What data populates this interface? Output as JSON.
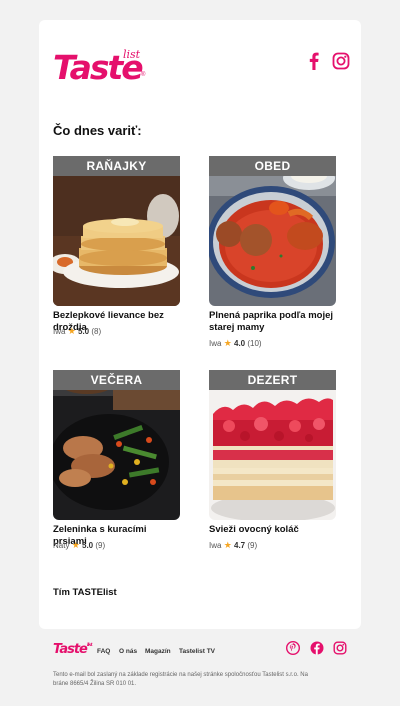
{
  "brand": {
    "name": "Taste",
    "suffix": "list",
    "accent": "#e5106c"
  },
  "header": {
    "social": [
      "facebook-icon",
      "instagram-icon"
    ]
  },
  "heading": "Čo dnes variť:",
  "recipes": [
    {
      "tag": "RAŇAJKY",
      "title": "Bezlepkové lievance bez droždia",
      "author": "Iwa",
      "rating": "5.0",
      "count": "(8)"
    },
    {
      "tag": "OBED",
      "title": "Plnená paprika podľa mojej starej mamy",
      "author": "Iwa",
      "rating": "4.0",
      "count": "(10)"
    },
    {
      "tag": "VEČERA",
      "title": "Zeleninka s kuracími prsiami",
      "author": "Naty",
      "rating": "5.0",
      "count": "(9)"
    },
    {
      "tag": "DEZERT",
      "title": "Svieži ovocný koláč",
      "author": "Iwa",
      "rating": "4.7",
      "count": "(9)"
    }
  ],
  "signoff": "Tím TASTElist",
  "footer": {
    "links": [
      "FAQ",
      "O nás",
      "Magazín",
      "Tastelist TV"
    ],
    "social": [
      "pinterest-icon",
      "facebook-icon",
      "instagram-icon"
    ],
    "legal": "Tento e-mail bol zaslaný na základe registrácie na našej stránke spoločnosťou Tastelist s.r.o. Na bráne 8665/4 Žilina SR 010 01."
  }
}
